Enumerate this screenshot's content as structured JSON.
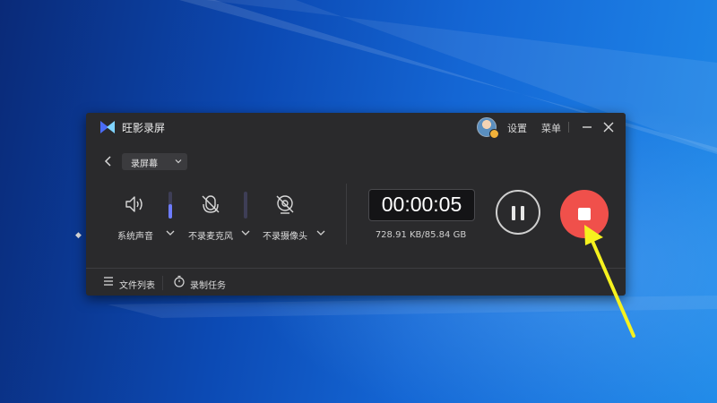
{
  "app": {
    "title": "旺影录屏"
  },
  "titlebar": {
    "settings_label": "设置",
    "menu_label": "菜单"
  },
  "mode_select": {
    "selected": "录屏幕"
  },
  "sources": {
    "system_audio": {
      "label": "系统声音",
      "icon": "speaker-icon",
      "volume": 0.55
    },
    "microphone": {
      "label": "不录麦克风",
      "icon": "mic-off-icon",
      "volume": 0.0
    },
    "camera": {
      "label": "不录摄像头",
      "icon": "camera-off-icon"
    }
  },
  "recording": {
    "elapsed": "00:00:05",
    "size": "728.91 KB/85.84 GB"
  },
  "footer": {
    "file_list_label": "文件列表",
    "tasks_label": "录制任务"
  },
  "colors": {
    "window_bg": "#2a2a2c",
    "stop_button": "#f0504b",
    "accent": "#6d7cff",
    "annotation_arrow": "#f6f21e"
  }
}
